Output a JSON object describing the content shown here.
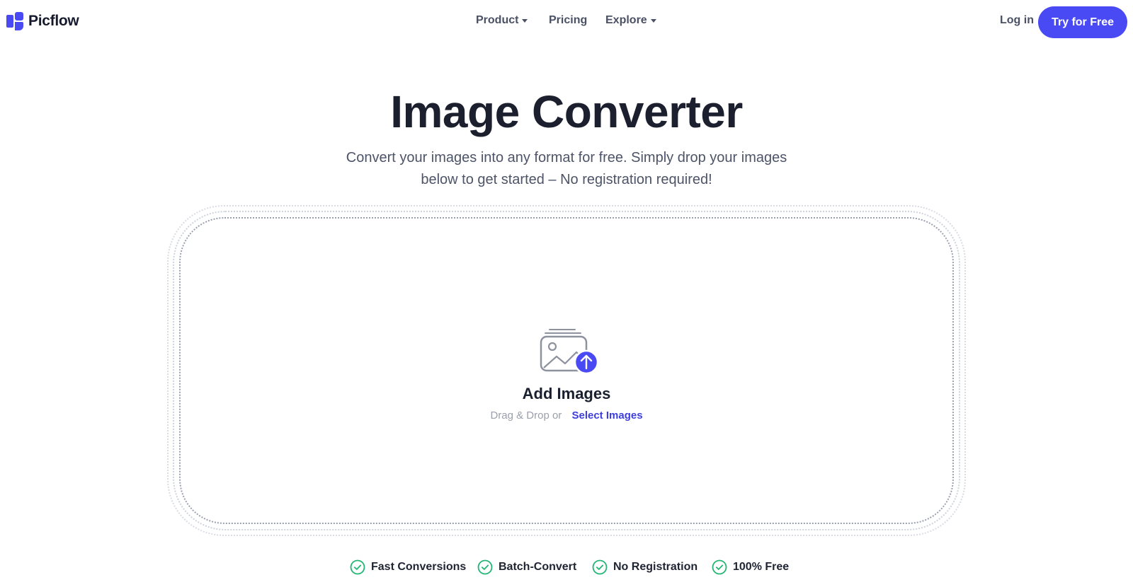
{
  "brand": {
    "name": "Picflow",
    "accent": "#4a4af5"
  },
  "nav": {
    "items": [
      {
        "label": "Product",
        "has_dropdown": true
      },
      {
        "label": "Pricing",
        "has_dropdown": false
      },
      {
        "label": "Explore",
        "has_dropdown": true
      }
    ],
    "login_label": "Log in",
    "cta_label": "Try for Free"
  },
  "hero": {
    "title": "Image Converter",
    "subtitle_line1": "Convert your images into any format for free. Simply drop your images",
    "subtitle_line2": "below to get started – No registration required!"
  },
  "dropzone": {
    "icon": "image-upload-icon",
    "title": "Add Images",
    "drag_text": "Drag & Drop or",
    "select_label": "Select Images"
  },
  "features": [
    {
      "label": "Fast Conversions",
      "icon": "check-circle-icon",
      "color": "#22b573"
    },
    {
      "label": "Batch-Convert",
      "icon": "check-circle-icon",
      "color": "#22b573"
    },
    {
      "label": "No Registration",
      "icon": "check-circle-icon",
      "color": "#22b573"
    },
    {
      "label": "100% Free",
      "icon": "check-circle-icon",
      "color": "#22b573"
    }
  ]
}
